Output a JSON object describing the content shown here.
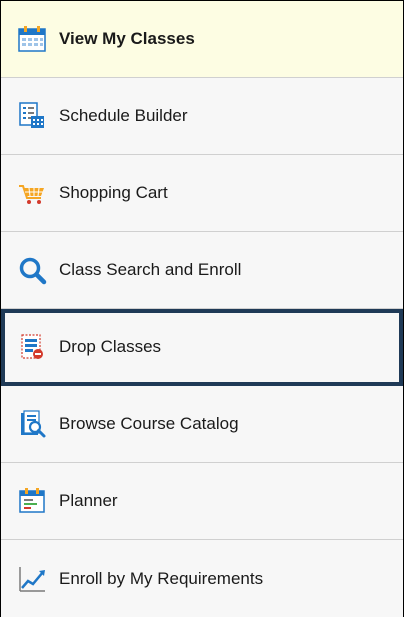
{
  "nav": {
    "items": [
      {
        "label": "View My Classes",
        "icon": "calendar-icon",
        "state": "active"
      },
      {
        "label": "Schedule Builder",
        "icon": "schedule-builder-icon",
        "state": "normal"
      },
      {
        "label": "Shopping Cart",
        "icon": "shopping-cart-icon",
        "state": "normal"
      },
      {
        "label": "Class Search and Enroll",
        "icon": "search-icon",
        "state": "normal"
      },
      {
        "label": "Drop Classes",
        "icon": "drop-classes-icon",
        "state": "focused"
      },
      {
        "label": "Browse Course Catalog",
        "icon": "course-catalog-icon",
        "state": "normal"
      },
      {
        "label": "Planner",
        "icon": "planner-icon",
        "state": "normal"
      },
      {
        "label": "Enroll by My Requirements",
        "icon": "requirements-chart-icon",
        "state": "normal"
      }
    ]
  },
  "colors": {
    "active_background": "#fdfde3",
    "focus_outline": "#1f3a57",
    "icon_blue": "#1f77c7",
    "icon_red": "#d33a2c",
    "cart_orange": "#f5a623"
  }
}
